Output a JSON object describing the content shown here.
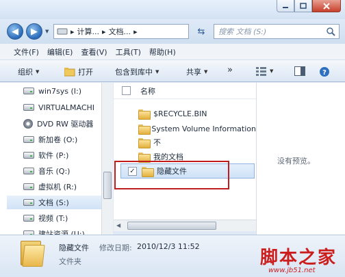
{
  "address": {
    "crumbs": [
      "计算...",
      "文档..."
    ],
    "search_placeholder": "搜索 文档 (S:)"
  },
  "menu": [
    "文件(F)",
    "编辑(E)",
    "查看(V)",
    "工具(T)",
    "帮助(H)"
  ],
  "toolbar": {
    "organize": "组织",
    "open": "打开",
    "include": "包含到库中",
    "share": "共享",
    "more": "»"
  },
  "nav": {
    "items": [
      {
        "label": "win7sys (I:)",
        "icon": "drive-icon"
      },
      {
        "label": "VIRTUALMACHI",
        "icon": "drive-icon"
      },
      {
        "label": "DVD RW 驱动器",
        "icon": "dvd-icon"
      },
      {
        "label": "新加卷 (O:)",
        "icon": "drive-icon"
      },
      {
        "label": "软件 (P:)",
        "icon": "drive-icon"
      },
      {
        "label": "音乐 (Q:)",
        "icon": "drive-icon"
      },
      {
        "label": "虚拟机 (R:)",
        "icon": "drive-icon"
      },
      {
        "label": "文档 (S:)",
        "icon": "drive-icon",
        "selected": true
      },
      {
        "label": "视频 (T:)",
        "icon": "drive-icon"
      },
      {
        "label": "建站资源 (U:)",
        "icon": "drive-icon"
      }
    ]
  },
  "filelist": {
    "header": "名称",
    "rows": [
      {
        "name": "$RECYCLE.BIN"
      },
      {
        "name": "System Volume Information"
      },
      {
        "name": "不"
      },
      {
        "name": "我的文档"
      },
      {
        "name": "隐藏文件",
        "selected": true,
        "checked": "✓"
      }
    ]
  },
  "preview": {
    "text": "没有预览。"
  },
  "details": {
    "name": "隐藏文件",
    "modified_label": "修改日期:",
    "modified_value": "2010/12/3 11:52",
    "type": "文件夹"
  },
  "watermark": {
    "text": "脚本之家",
    "url": "www.jb51.net"
  },
  "colors": {
    "accent": "#2a6ab8",
    "highlight": "#c21b1b",
    "watermark": "#cc1d1d"
  }
}
